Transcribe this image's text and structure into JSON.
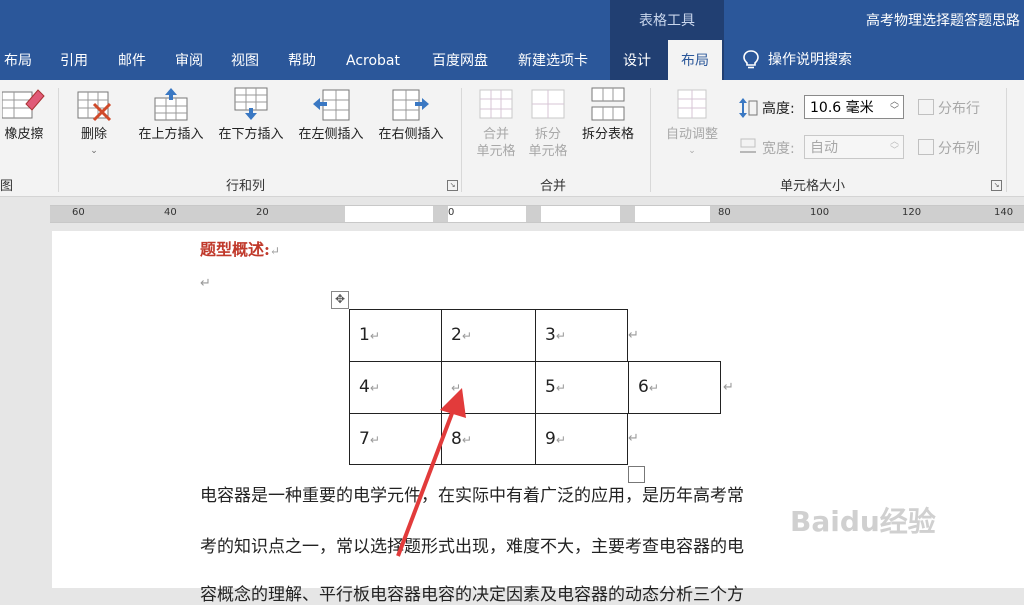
{
  "window": {
    "context_title": "表格工具",
    "doc_title": "高考物理选择题答题思路"
  },
  "tabs": [
    {
      "label": "布局"
    },
    {
      "label": "引用"
    },
    {
      "label": "邮件"
    },
    {
      "label": "审阅"
    },
    {
      "label": "视图"
    },
    {
      "label": "帮助"
    },
    {
      "label": "Acrobat"
    },
    {
      "label": "百度网盘"
    },
    {
      "label": "新建选项卡"
    },
    {
      "label": "设计"
    },
    {
      "label": "布局",
      "active": true
    },
    {
      "label": "操作说明搜索",
      "icon": "lightbulb-icon"
    }
  ],
  "ribbon": {
    "eraser": {
      "label": "橡皮擦",
      "icon": "eraser-icon"
    },
    "delete": {
      "label": "删除",
      "icon": "delete-table-icon"
    },
    "insert_above": {
      "label": "在上方插入",
      "icon": "insert-above-icon"
    },
    "insert_below": {
      "label": "在下方插入",
      "icon": "insert-below-icon"
    },
    "insert_left": {
      "label": "在左侧插入",
      "icon": "insert-left-icon"
    },
    "insert_right": {
      "label": "在右侧插入",
      "icon": "insert-right-icon"
    },
    "merge_cells": {
      "line1": "合并",
      "line2": "单元格",
      "icon": "merge-cells-icon"
    },
    "split_cells": {
      "line1": "拆分",
      "line2": "单元格",
      "icon": "split-cells-icon"
    },
    "split_table": {
      "label": "拆分表格",
      "icon": "split-table-icon"
    },
    "autofit": {
      "label": "自动调整",
      "icon": "autofit-icon"
    },
    "height_label": "高度:",
    "height_value": "10.6 毫米",
    "width_label": "宽度:",
    "width_value": "自动",
    "distribute_rows": "分布行",
    "distribute_cols": "分布列",
    "groups": {
      "draw": "图",
      "rows_cols": "行和列",
      "merge": "合并",
      "cell_size": "单元格大小"
    }
  },
  "ruler": {
    "labels": [
      "60",
      "40",
      "20",
      "0",
      "80",
      "100",
      "120",
      "140"
    ]
  },
  "document": {
    "heading": "题型概述:",
    "table": [
      [
        "1",
        "2",
        "3",
        ""
      ],
      [
        "4",
        "",
        "5",
        "6"
      ],
      [
        "7",
        "8",
        "9",
        ""
      ]
    ],
    "paragraph_lines": [
      "电容器是一种重要的电学元件，在实际中有着广泛的应用，是历年高考常",
      "考的知识点之一，常以选择题形式出现，难度不大，主要考查电容器的电",
      "容概念的理解、平行板电容器电容的决定因素及电容器的动态分析三个方"
    ],
    "watermark": "Baidu经验"
  },
  "colors": {
    "ribbon_blue": "#2b579a",
    "context_dark": "#213f72",
    "heading_red": "#c0392b",
    "arrow_red": "#e23b3b"
  }
}
